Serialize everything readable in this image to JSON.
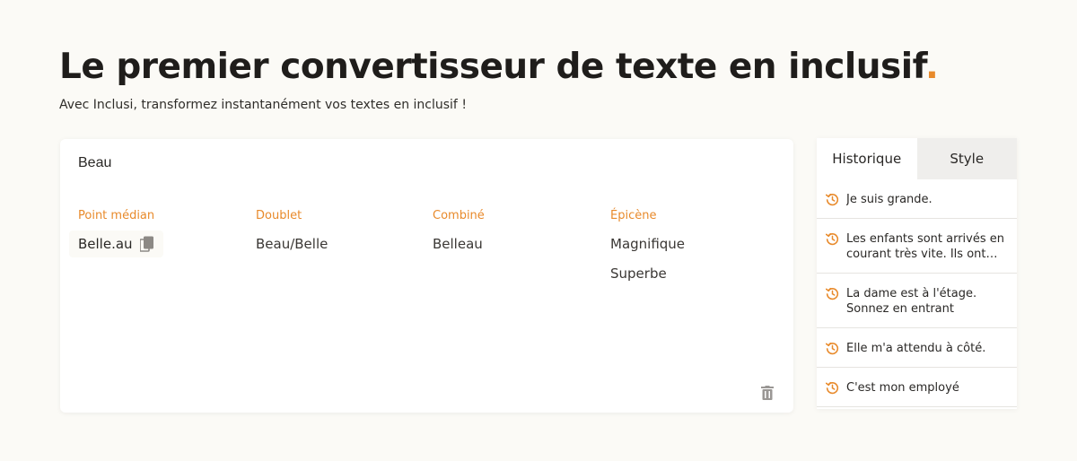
{
  "header": {
    "title": "Le premier convertisseur de texte en inclusif",
    "title_dot": ".",
    "subtitle": "Avec Inclusi, transformez instantanément vos textes en inclusif !"
  },
  "editor": {
    "input_value": "Beau",
    "columns": [
      {
        "heading": "Point médian",
        "items": [
          "Belle.au"
        ]
      },
      {
        "heading": "Doublet",
        "items": [
          "Beau/Belle"
        ]
      },
      {
        "heading": "Combiné",
        "items": [
          "Belleau"
        ]
      },
      {
        "heading": "Épicène",
        "items": [
          "Magnifique",
          "Superbe"
        ]
      }
    ]
  },
  "panel": {
    "tabs": [
      "Historique",
      "Style"
    ],
    "active_tab": "Historique",
    "history": [
      "Je suis grande.",
      "Les enfants sont arrivés en courant très vite. Ils ont failli tomber.",
      "La dame est à l'étage. Sonnez en entrant",
      "Elle m'a attendu à côté.",
      "C'est mon employé"
    ]
  },
  "colors": {
    "accent": "#e88a2b",
    "background": "#fbfaf6",
    "card": "#ffffff",
    "tab_inactive": "#efeeec"
  },
  "icons": [
    "copy-icon",
    "trash-icon",
    "history-icon"
  ]
}
